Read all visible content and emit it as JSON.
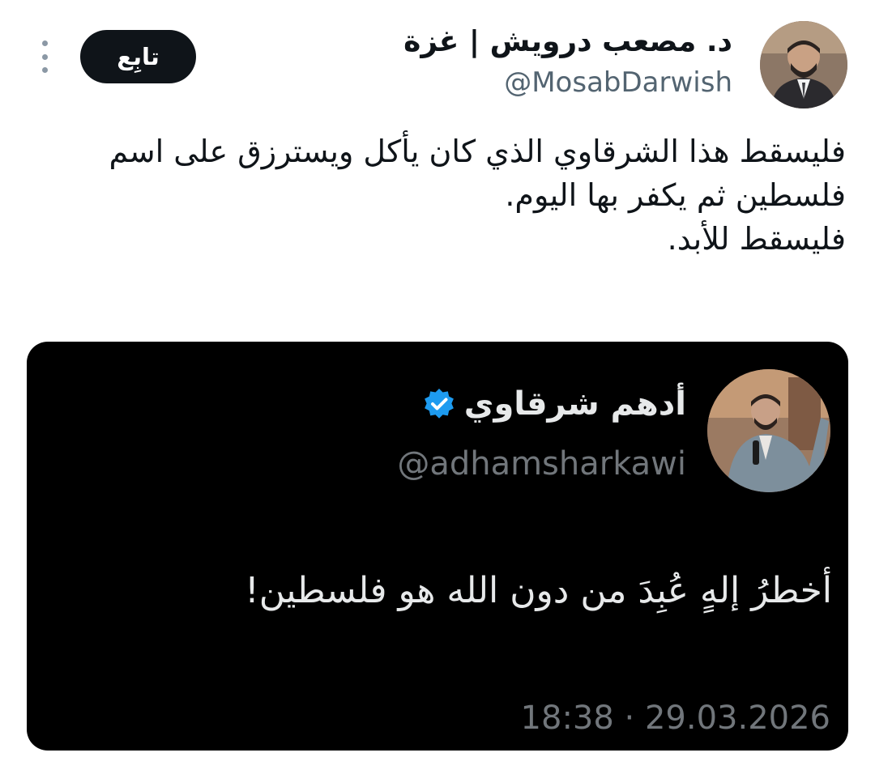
{
  "header": {
    "display_name": "د. مصعب درويش | غزة",
    "handle": "@MosabDarwish",
    "follow_label": "تابِع",
    "avatar_icon": "user-avatar-photo",
    "more_icon": "more-vertical-icon"
  },
  "tweet": {
    "lines": [
      "فليسقط هذا الشرقاوي الذي كان يأكل ويسترزق على اسم",
      "فلسطين ثم يكفر بها اليوم.",
      "فليسقط للأبد."
    ]
  },
  "quoted": {
    "display_name": "أدهم شرقاوي",
    "handle": "@adhamsharkawi",
    "text": "أخطرُ إلهٍ عُبِدَ من دون الله هو فلسطين!",
    "timestamp": "18:38 · 29.03.2026",
    "verified_icon": "verified-badge-icon",
    "verified_color": "#1d9bf0"
  },
  "colors": {
    "text_primary": "#0f1419",
    "text_secondary": "#536471",
    "follow_bg": "#0f1419",
    "card_bg": "#000000",
    "card_text": "#e7e9ea",
    "card_secondary": "#71767b"
  }
}
